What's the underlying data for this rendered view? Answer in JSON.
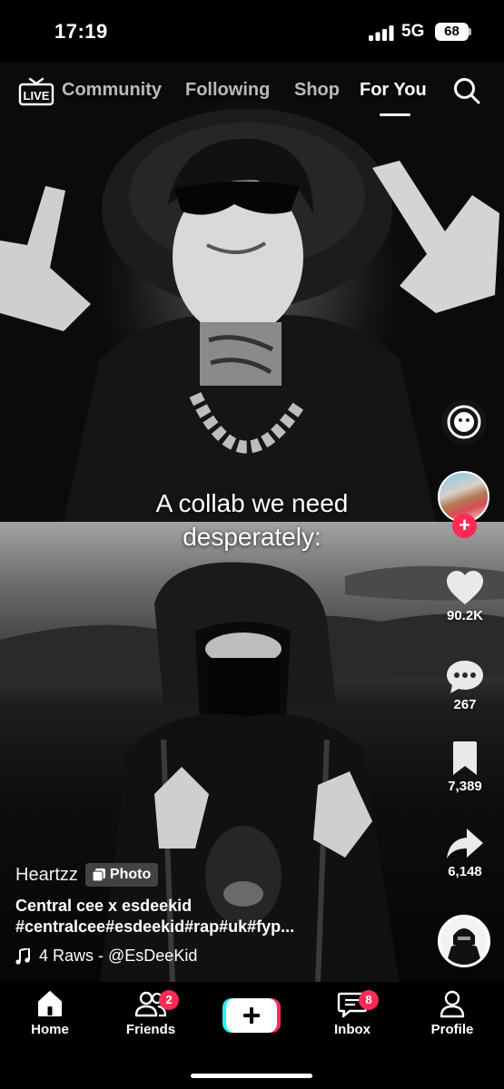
{
  "status_bar": {
    "time": "17:19",
    "network": "5G",
    "battery": "68"
  },
  "top_nav": {
    "live_label": "LIVE",
    "tabs": [
      {
        "label": "Community",
        "active": false
      },
      {
        "label": "Following",
        "active": false
      },
      {
        "label": "Shop",
        "active": false
      },
      {
        "label": "For You",
        "active": true
      }
    ]
  },
  "post": {
    "caption_line1": "A collab we need",
    "caption_line2": "desperately:",
    "author": "Heartzz",
    "badge": "Photo",
    "title": "Central cee x esdeekid",
    "hashtags": "#centralcee#esdeekid#rap#uk#fyp...",
    "sound": "4 Raws - @EsDeeKid"
  },
  "actions": {
    "likes": "90.2K",
    "comments": "267",
    "saves": "7,389",
    "shares": "6,148"
  },
  "tabbar": {
    "items": [
      {
        "label": "Home"
      },
      {
        "label": "Friends",
        "badge": "2"
      },
      {
        "label": "Inbox",
        "badge": "8"
      },
      {
        "label": "Profile"
      }
    ]
  },
  "colors": {
    "accent": "#ff2b55",
    "background": "#000000",
    "cyan": "#25f4ee"
  }
}
